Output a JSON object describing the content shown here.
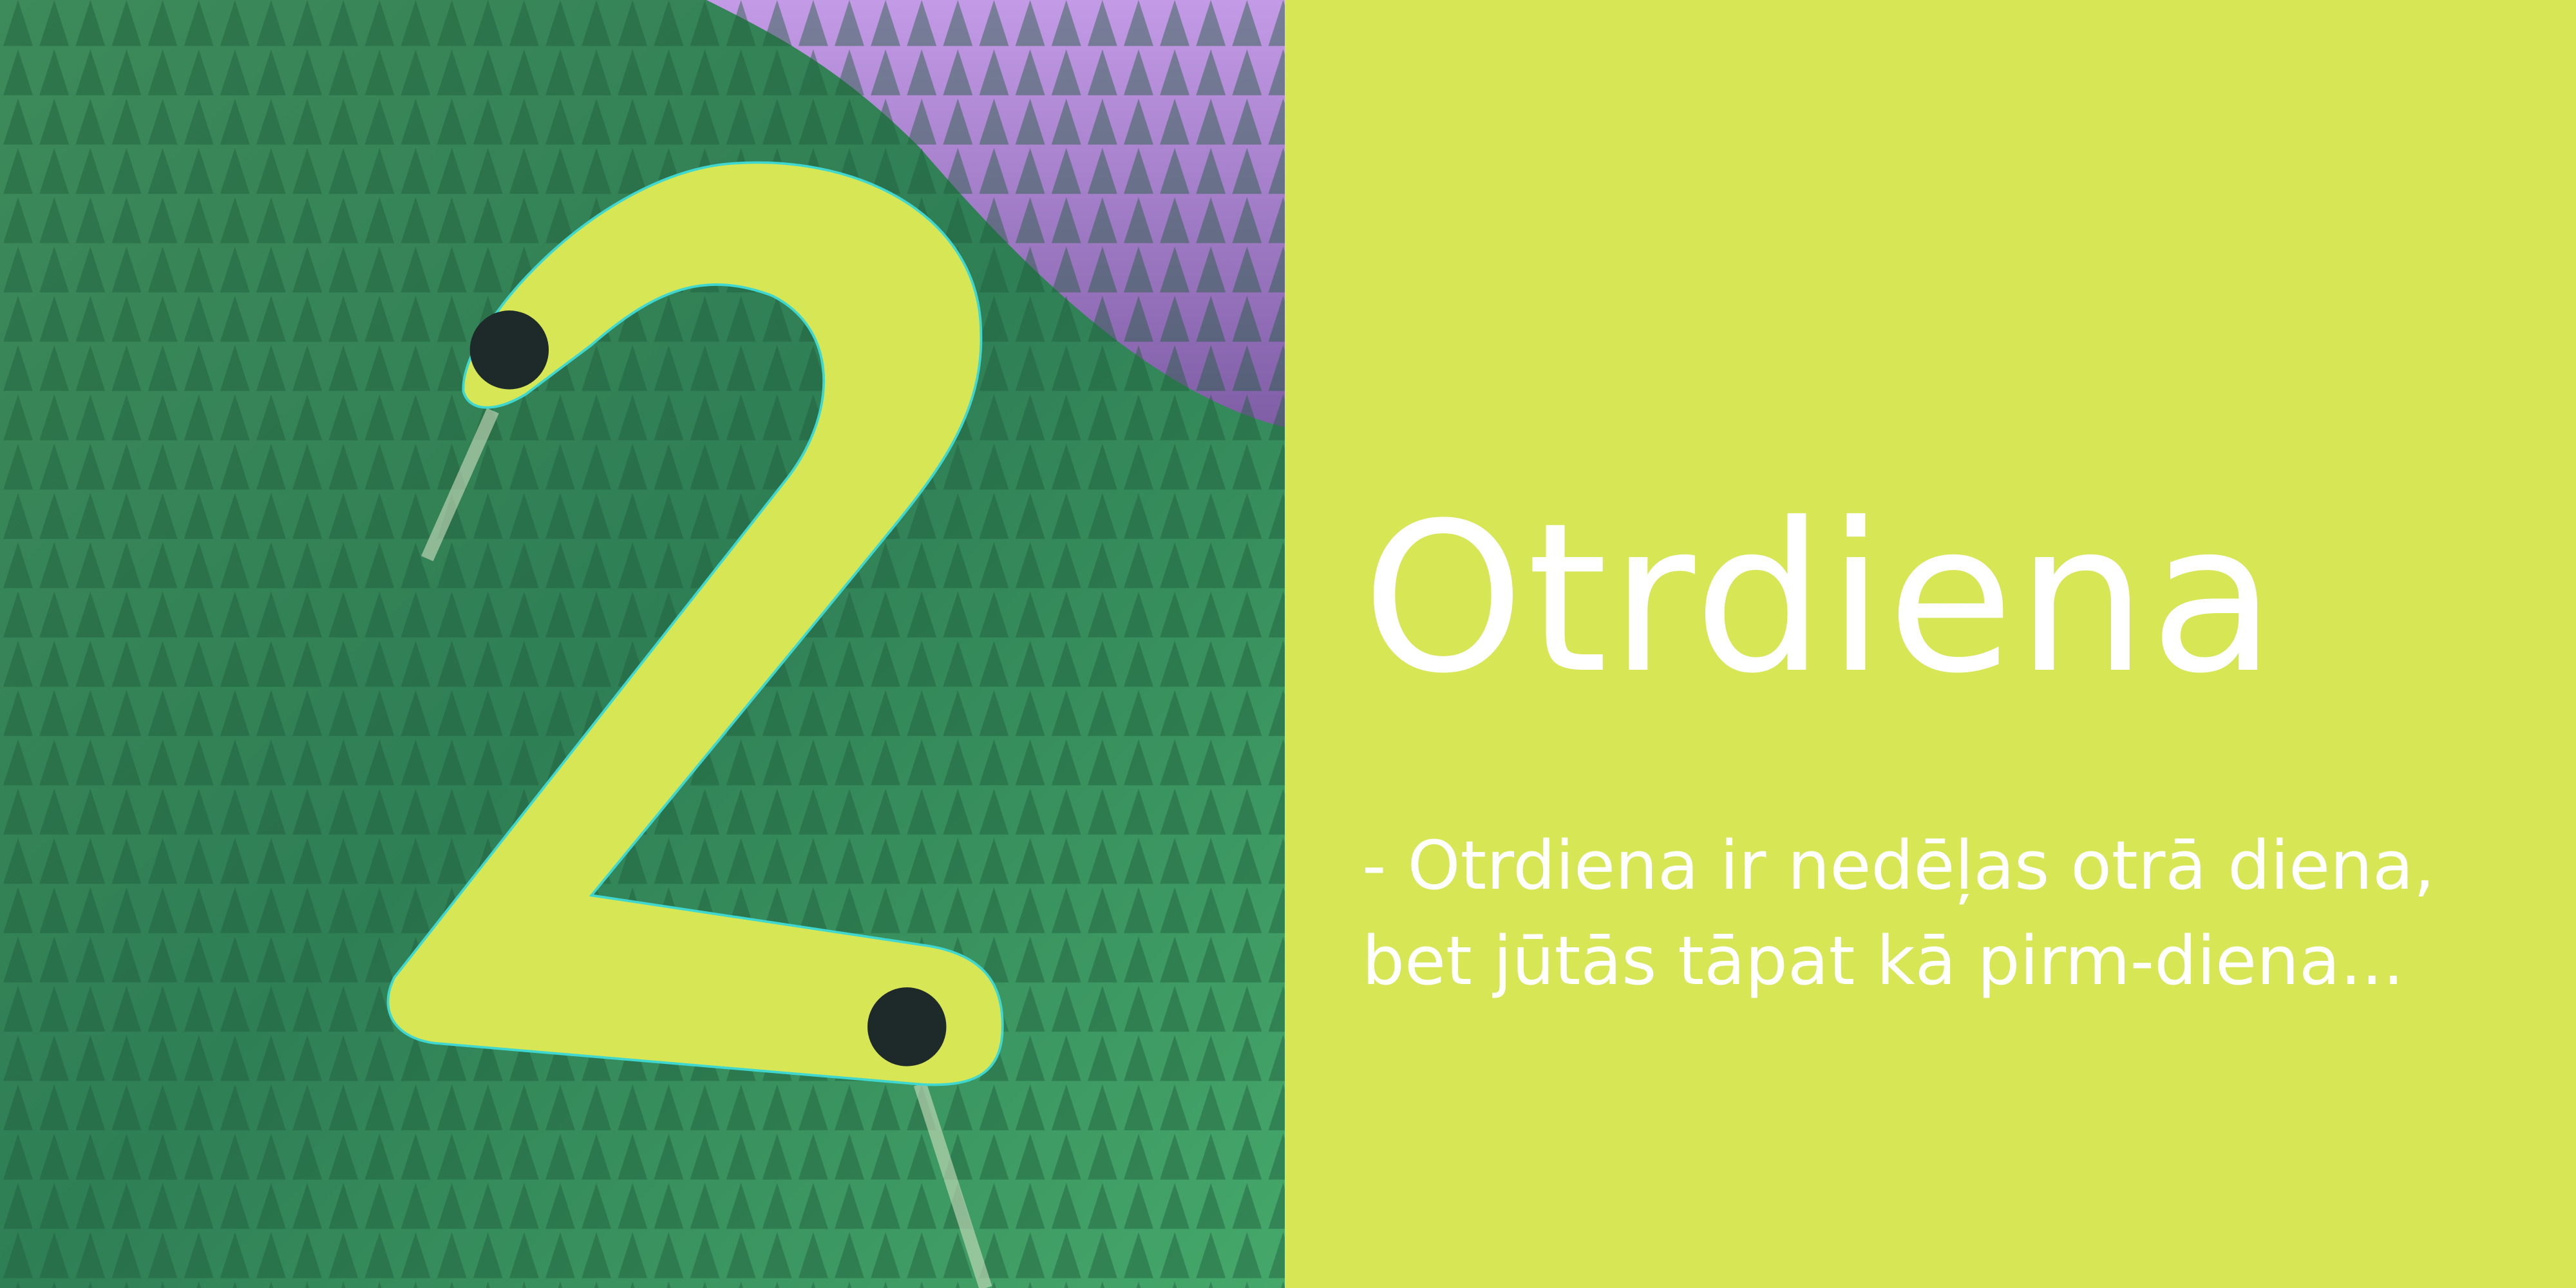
{
  "number": "2",
  "title": "Otrdiena",
  "description": "- Otrdiena ir nedēļas otrā diena, bet jūtās tāpat kā pirm-diena...",
  "colors": {
    "panel": "#d6e655",
    "text": "#ffffff",
    "forest": "#2f8a55",
    "mountain": "#9a6fc4"
  }
}
